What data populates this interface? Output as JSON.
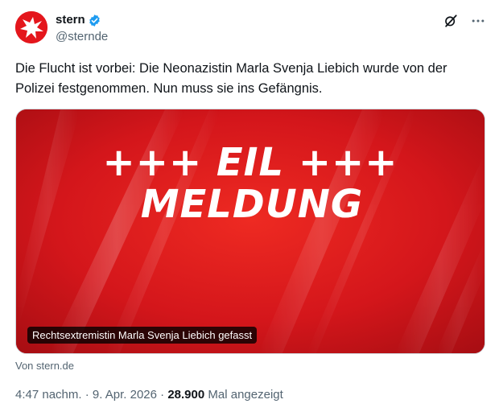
{
  "account": {
    "name": "stern",
    "handle": "@sterndе"
  },
  "tweet": {
    "text": "Die Flucht ist vorbei: Die Neonazistin Marla Svenja Liebich wurde von der Polizei festgenommen. Nun muss sie ins Gefängnis."
  },
  "media": {
    "headline_line1": "+++ EIL +++",
    "headline_line2": "MELDUNG",
    "caption": "Rechtsextremistin Marla Svenja Liebich gefasst",
    "source": "Von stern.de"
  },
  "meta": {
    "time": "4:47 nachm.",
    "separator": "·",
    "date": "9. Apr. 2026",
    "views_count": "28.900",
    "views_label": "Mal angezeigt"
  },
  "icons": {
    "verified": "verified-badge-icon",
    "grok": "grok-icon",
    "more": "more-icon"
  },
  "colors": {
    "brand_red": "#e4161c",
    "verified_blue": "#1d9bf0",
    "secondary_text": "#536471"
  }
}
